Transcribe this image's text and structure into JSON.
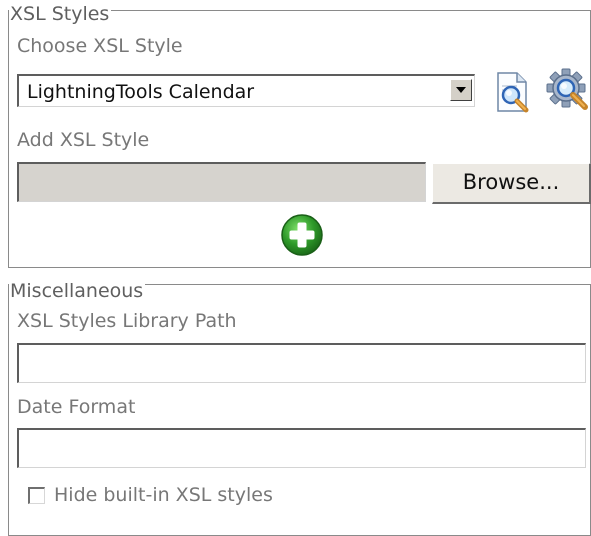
{
  "xsl_styles": {
    "legend": "XSL Styles",
    "choose_label": "Choose XSL Style",
    "selected_style": "LightningTools Calendar",
    "add_label": "Add XSL Style",
    "browse_label": "Browse..."
  },
  "misc": {
    "legend": "Miscellaneous",
    "library_path_label": "XSL Styles Library Path",
    "library_path_value": "",
    "date_format_label": "Date Format",
    "date_format_value": "",
    "hide_builtin_label": "Hide built-in XSL styles",
    "hide_builtin_checked": false
  },
  "icons": {
    "preview": "document-magnifier-icon",
    "settings": "gear-magnifier-icon",
    "add": "green-plus-icon"
  },
  "colors": {
    "add_icon": "#2f9a2a",
    "field_disabled": "#d6d3ce"
  }
}
